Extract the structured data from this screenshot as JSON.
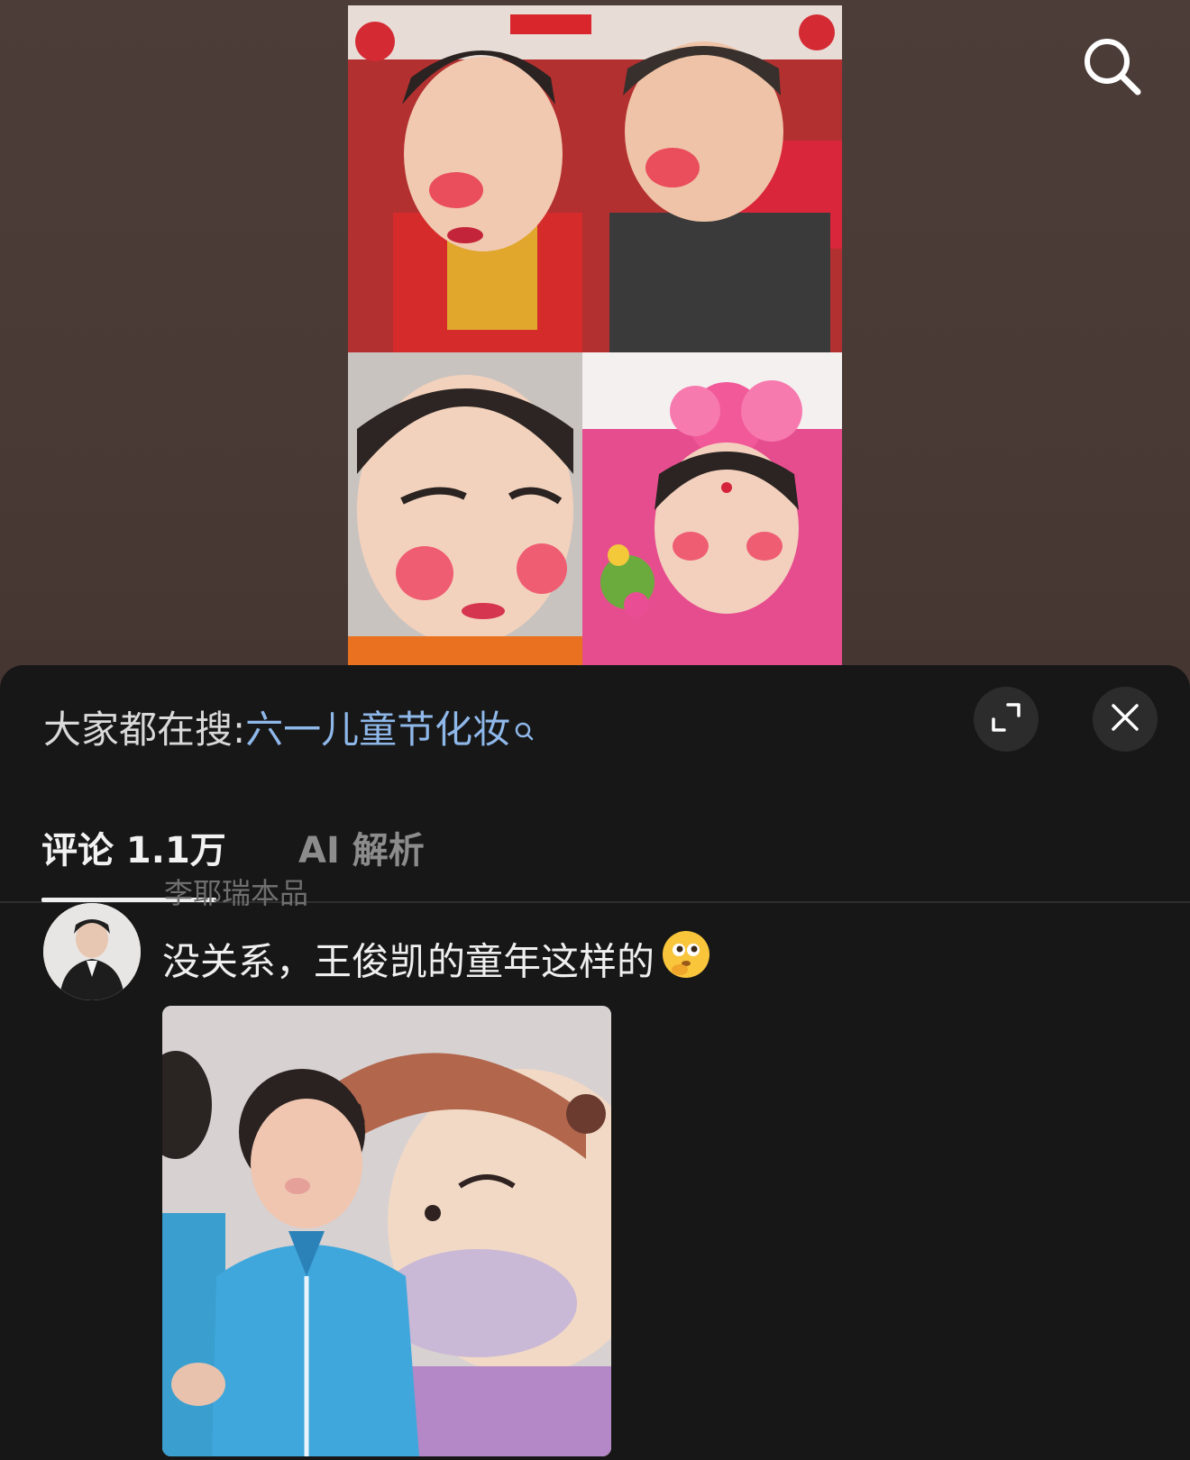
{
  "video": {
    "image_label": "children with stage makeup collage"
  },
  "top_bar": {
    "search_icon": "search-icon"
  },
  "comment_sheet": {
    "hot_search_prefix": "大家都在搜",
    "hot_search_colon": ":",
    "hot_search_term": "六一儿童节化妆",
    "hot_search_icon": "search-mini-icon",
    "expand_icon": "expand-icon",
    "close_icon": "close-icon",
    "tabs": [
      {
        "label": "评论 1.1万",
        "active": true
      },
      {
        "label": "AI 解析",
        "active": false
      }
    ],
    "comments": [
      {
        "username": "李耶瑞本品",
        "text": "没关系，王俊凯的童年这样的",
        "emoji": "thinking-face-emoji",
        "image_label": "childhood photo of boy in blue shirt"
      }
    ]
  },
  "colors": {
    "sheet_bg": "#171717",
    "link_blue": "#8fb8ea",
    "background": "#4a3a36"
  }
}
